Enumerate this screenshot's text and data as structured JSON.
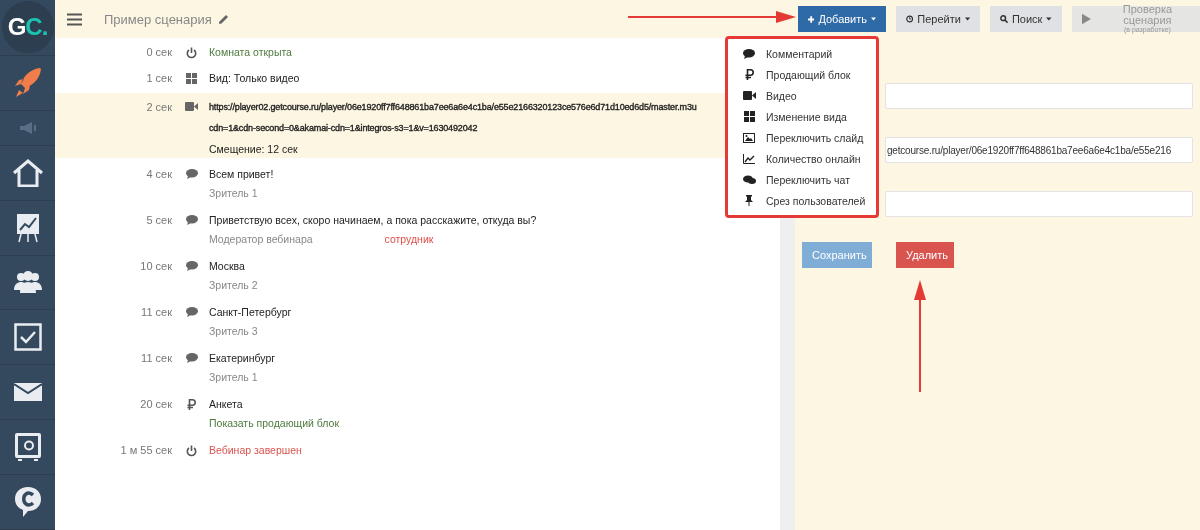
{
  "logo": "GC.",
  "header": {
    "title": "Пример сценария"
  },
  "toolbar": [
    {
      "kind": "primary",
      "label": "Добавить"
    },
    {
      "kind": "goto",
      "label": "Перейти"
    },
    {
      "kind": "search",
      "label": "Поиск"
    },
    {
      "kind": "disabled",
      "label": "Проверка сценария",
      "sublabel": "(в разработке)"
    }
  ],
  "add_menu": [
    "Комментарий",
    "Продающий блок",
    "Видео",
    "Изменение вида",
    "Переключить слайд",
    "Количество онлайн",
    "Переключить чат",
    "Срез пользователей"
  ],
  "events": [
    {
      "time": "0 сек",
      "kind": "power",
      "text": "Комната открыта",
      "color": "#4e7a3e",
      "selected": false
    },
    {
      "time": "1 сек",
      "kind": "layout",
      "text": "Вид: Только видео",
      "color": "#222222",
      "selected": false
    },
    {
      "time": "2 сек",
      "kind": "video",
      "text": "https://player02.getcourse.ru/player/06e1920ff7ff648861ba7ee6a6e4c1ba/e55e2166320123ce576e6d71d10ed6d5/master.m3u",
      "color": "#222222",
      "selected": true,
      "details": [
        "cdn=1&cdn-second=0&akamai-cdn=1&integros-s3=1&v=1630492042",
        "Смещение: 12 сек"
      ]
    },
    {
      "time": "4 сек",
      "kind": "comment",
      "text": "Всем привет!",
      "color": "#222222",
      "selected": false,
      "author": "Зритель 1"
    },
    {
      "time": "5 сек",
      "kind": "comment",
      "text": "Приветствую всех, скоро начинаем, а пока расскажите, откуда вы?",
      "color": "#222222",
      "selected": false,
      "author": "Модератор вебинара",
      "badge": "сотрудник"
    },
    {
      "time": "10 сек",
      "kind": "comment",
      "text": "Москва",
      "color": "#222222",
      "selected": false,
      "author": "Зритель 2"
    },
    {
      "time": "11 сек",
      "kind": "comment",
      "text": "Санкт-Петербург",
      "color": "#222222",
      "selected": false,
      "author": "Зритель 3"
    },
    {
      "time": "11 сек",
      "kind": "comment",
      "text": "Екатеринбург",
      "color": "#222222",
      "selected": false,
      "author": "Зритель 1"
    },
    {
      "time": "20 сек",
      "kind": "ruble",
      "text": "Анкета",
      "color": "#222222",
      "selected": false,
      "action": "Показать продающий блок"
    },
    {
      "time": "1 м 55 сек",
      "kind": "power",
      "text": "Вебинар завершен",
      "color": "#d9534f",
      "selected": false
    }
  ],
  "editor": {
    "fields": [
      {
        "kind": "empty"
      },
      {
        "kind": "filled",
        "value": "getcourse.ru/player/06e1920ff7ff648861ba7ee6a6e4c1ba/e55e216"
      },
      {
        "kind": "empty"
      }
    ],
    "buttons": [
      {
        "kind": "save",
        "label": "Сохранить"
      },
      {
        "kind": "delete",
        "label": "Удалить"
      }
    ]
  }
}
